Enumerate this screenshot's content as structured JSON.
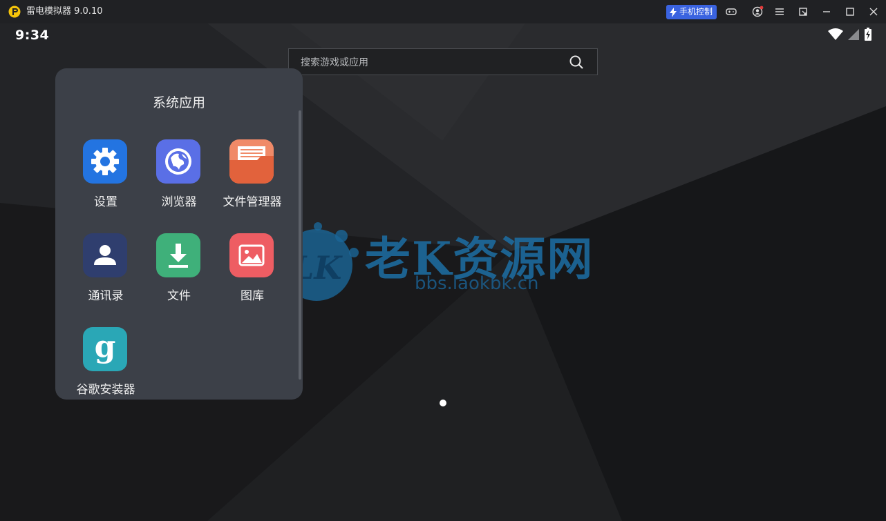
{
  "window": {
    "title": "雷电模拟器 9.0.10",
    "phone_control_label": "手机控制",
    "accent_color": "#3a63e0"
  },
  "status_bar": {
    "time": "9:34",
    "icons": [
      "wifi-icon",
      "signal-icon",
      "battery-charging-icon"
    ]
  },
  "search": {
    "placeholder": "搜索游戏或应用",
    "icon": "search-icon"
  },
  "folder": {
    "title": "系统应用",
    "apps": [
      {
        "label": "设置",
        "icon": "gear-icon",
        "color": "#2374e1"
      },
      {
        "label": "浏览器",
        "icon": "globe-icon",
        "color": "#5a6fe6"
      },
      {
        "label": "文件管理器",
        "icon": "folder-icon",
        "color": "#e2623c"
      },
      {
        "label": "通讯录",
        "icon": "contact-icon",
        "color": "#2f3e6e"
      },
      {
        "label": "文件",
        "icon": "download-icon",
        "color": "#3fb07a"
      },
      {
        "label": "图库",
        "icon": "image-icon",
        "color": "#ee5d63"
      },
      {
        "label": "谷歌安装器",
        "icon": "google-installer-icon",
        "color": "#2aa7b6"
      }
    ]
  },
  "watermark": {
    "text": "老K资源网",
    "url": "bbs.laokbk.cn",
    "logo_text": "LK"
  }
}
